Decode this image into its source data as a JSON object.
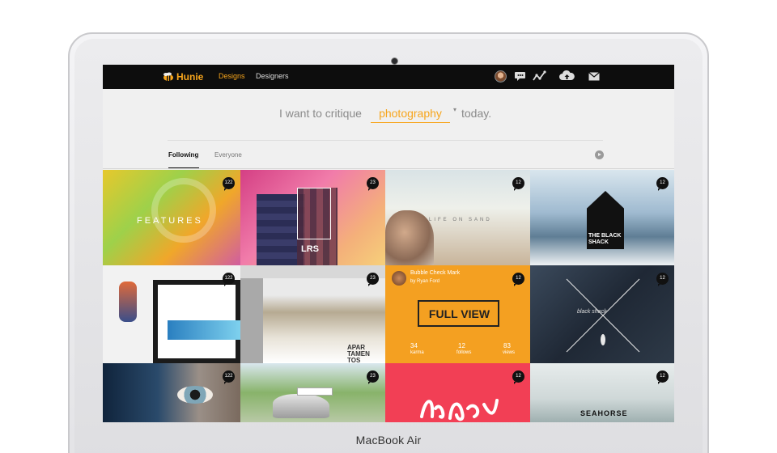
{
  "device": {
    "label": "MacBook Air"
  },
  "nav": {
    "logo_text": "Hunie",
    "links": [
      {
        "label": "Designs",
        "active": true
      },
      {
        "label": "Designers",
        "active": false
      }
    ],
    "icons": [
      "avatar",
      "chat-icon",
      "activity-icon",
      "upload-cloud-icon",
      "mail-icon"
    ]
  },
  "critique": {
    "prefix": "I want to critique",
    "keyword": "photography",
    "suffix": "today."
  },
  "tabs": [
    {
      "label": "Following",
      "active": true
    },
    {
      "label": "Everyone",
      "active": false
    }
  ],
  "tiles": [
    {
      "id": "features",
      "badge": "122",
      "text": "FEATURES"
    },
    {
      "id": "lrs",
      "badge": "23",
      "text": "LRS"
    },
    {
      "id": "beach",
      "badge": "12",
      "text": "LIFE ON SAND"
    },
    {
      "id": "black-shack",
      "badge": "12",
      "text": "THE BLACK SHACK"
    },
    {
      "id": "website",
      "badge": "122",
      "text": ""
    },
    {
      "id": "aparta",
      "badge": "23",
      "text": "APAR TAMEN TOS"
    },
    {
      "id": "bubble",
      "badge": "12",
      "title": "Bubble Check Mark",
      "author": "by Ryan Ford",
      "cta": "FULL VIEW",
      "stats": [
        {
          "value": "34",
          "label": "karma"
        },
        {
          "value": "12",
          "label": "follows"
        },
        {
          "value": "83",
          "label": "views"
        }
      ]
    },
    {
      "id": "blackshack-wood",
      "badge": "12",
      "text": "black shack"
    },
    {
      "id": "eye",
      "badge": "122",
      "text": ""
    },
    {
      "id": "car",
      "badge": "23",
      "text": ""
    },
    {
      "id": "red",
      "badge": "12",
      "text": ""
    },
    {
      "id": "seahorse",
      "badge": "12",
      "text": "SEAHORSE"
    }
  ],
  "colors": {
    "accent": "#f7a51c",
    "topbar": "#0d0d0d",
    "badge": "#111111"
  }
}
